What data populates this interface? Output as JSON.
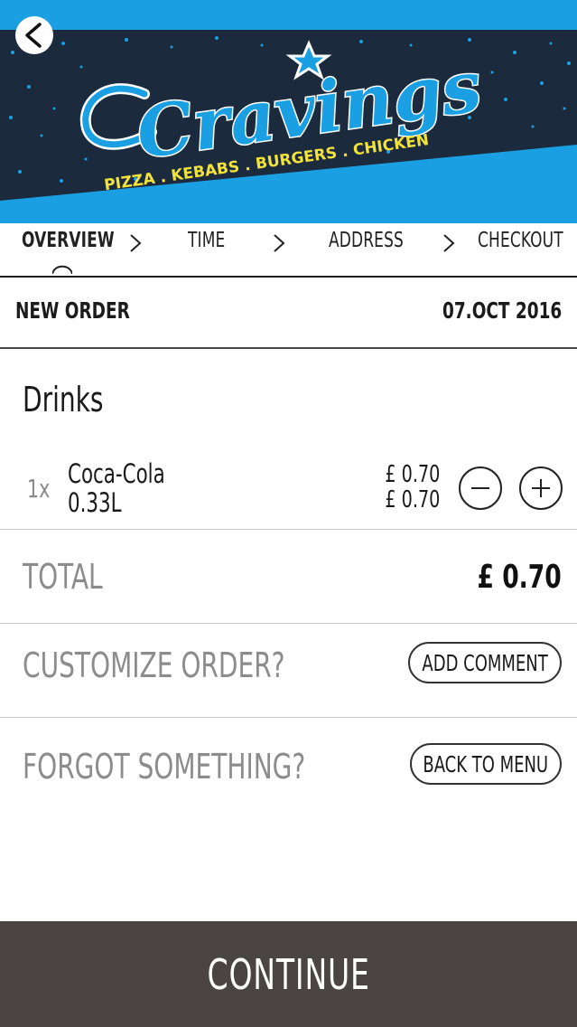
{
  "banner": {
    "brand_name": "Cravings",
    "tagline": "PIZZA . KEBABS . BURGERS . CHICKEN",
    "colors": {
      "sky": "#1aa0e2",
      "navy": "#1b2a3c",
      "brand": "#1aa0e2",
      "tagline": "#f2e23a"
    }
  },
  "nav": {
    "back_icon": "chevron-left-icon"
  },
  "steps": [
    {
      "label": "OVERVIEW",
      "active": true
    },
    {
      "label": "TIME",
      "active": false
    },
    {
      "label": "ADDRESS",
      "active": false
    },
    {
      "label": "CHECKOUT",
      "active": false
    }
  ],
  "order": {
    "label": "NEW ORDER",
    "date": "07.OCT 2016"
  },
  "section": {
    "title": "Drinks"
  },
  "items": [
    {
      "qty": "1x",
      "name_line1": "Coca-Cola",
      "name_line2": "0.33L",
      "unit_price": "£ 0.70",
      "line_price": "£ 0.70"
    }
  ],
  "total": {
    "label": "TOTAL",
    "value": "£ 0.70"
  },
  "customize": {
    "label": "CUSTOMIZE ORDER?",
    "button": "ADD COMMENT"
  },
  "forgot": {
    "label": "FORGOT SOMETHING?",
    "button": "BACK TO MENU"
  },
  "continue_label": "CONTINUE"
}
